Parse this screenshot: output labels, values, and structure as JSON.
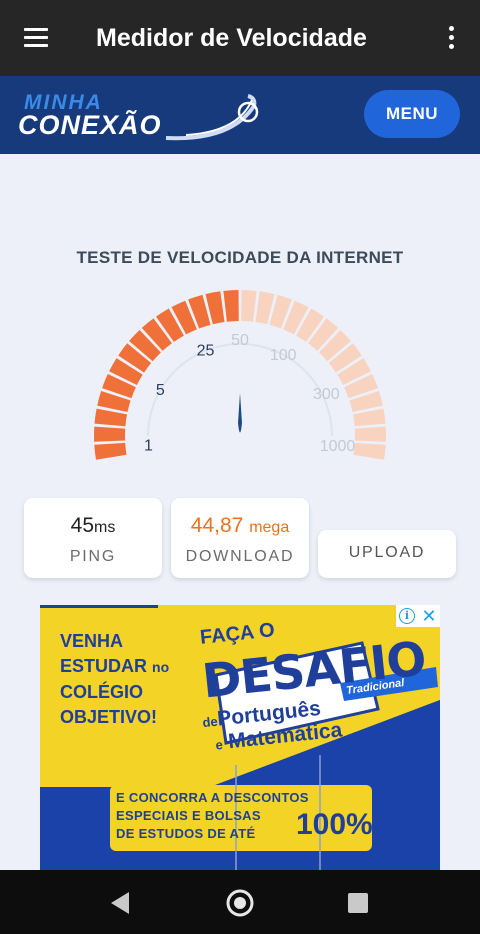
{
  "app_bar": {
    "title": "Medidor de Velocidade",
    "menu_icon": "hamburger-menu-icon",
    "overflow_icon": "more-vert-icon",
    "background": "#262626"
  },
  "site_header": {
    "logo_line1": "MINHA",
    "logo_line2": "CONEXÃO",
    "menu_button": "MENU",
    "background": "#163a7c",
    "button_color": "#2165db"
  },
  "speed_test": {
    "title": "TESTE DE VELOCIDADE DA INTERNET",
    "scale_labels": [
      "1",
      "5",
      "25",
      "50",
      "100",
      "300",
      "1000"
    ],
    "gauge_fill_fraction": 0.5,
    "needle_value": "50",
    "active_color": "#f0703a",
    "inactive_color": "#f8d3c0",
    "ping": {
      "value": "45",
      "unit": "ms",
      "label": "PING"
    },
    "download": {
      "value": "44,87",
      "unit": "mega",
      "label": "DOWNLOAD",
      "color": "#e9731f"
    },
    "upload": {
      "label": "UPLOAD"
    }
  },
  "ad": {
    "left_text": [
      "VENHA",
      "ESTUDAR",
      "no",
      "COLÉGIO",
      "OBJETIVO!"
    ],
    "headline_pre": "FAÇA O",
    "headline": "DESAFIO",
    "badge": "Tradicional",
    "subject1_prefix": "de",
    "subject1": "Português",
    "subject2_prefix": "e",
    "subject2": "Matemática",
    "bottom_lines": [
      "E CONCORRA A DESCONTOS",
      "ESPECIAIS E BOLSAS",
      "DE ESTUDOS DE ATÉ"
    ],
    "percent": "100%",
    "info_icon": "info-icon",
    "close_icon": "close-icon",
    "colors": {
      "yellow": "#f3d325",
      "blue": "#1a42a8"
    }
  },
  "nav_bar": {
    "back_icon": "back-triangle-icon",
    "home_icon": "home-circle-icon",
    "recents_icon": "recents-square-icon"
  }
}
